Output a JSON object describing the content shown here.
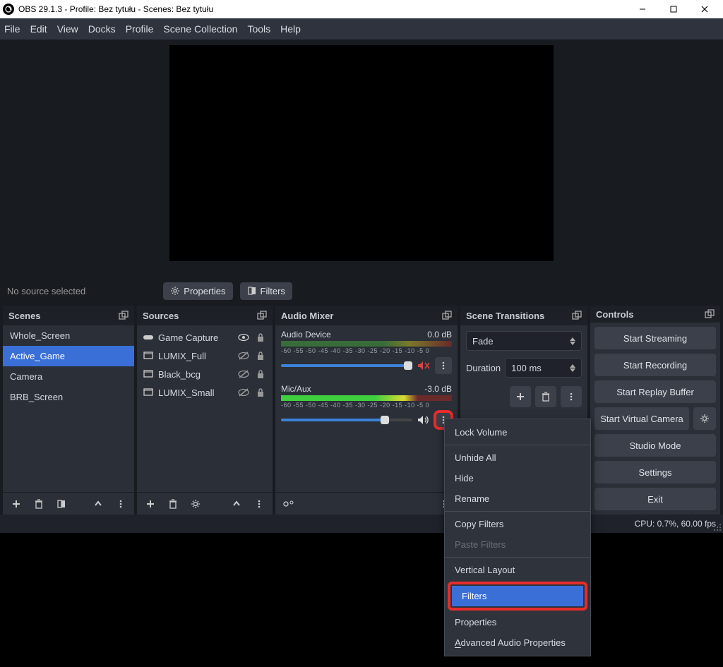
{
  "window": {
    "title": "OBS 29.1.3 - Profile: Bez tytułu - Scenes: Bez tytułu"
  },
  "menubar": [
    "File",
    "Edit",
    "View",
    "Docks",
    "Profile",
    "Scene Collection",
    "Tools",
    "Help"
  ],
  "toolbar": {
    "no_source": "No source selected",
    "properties": "Properties",
    "filters": "Filters"
  },
  "scenes": {
    "title": "Scenes",
    "items": [
      "Whole_Screen",
      "Active_Game",
      "Camera",
      "BRB_Screen"
    ],
    "active_index": 1
  },
  "sources": {
    "title": "Sources",
    "items": [
      {
        "name": "Game Capture",
        "icon": "gamepad",
        "visible": true,
        "locked": true
      },
      {
        "name": "LUMIX_Full",
        "icon": "monitor",
        "visible": false,
        "locked": true
      },
      {
        "name": "Black_bcg",
        "icon": "monitor",
        "visible": false,
        "locked": true
      },
      {
        "name": "LUMIX_Small",
        "icon": "monitor",
        "visible": false,
        "locked": true
      }
    ]
  },
  "audio": {
    "title": "Audio Mixer",
    "ticks": "-60 -55 -50 -45 -40 -35 -30 -25 -20 -15 -10 -5 0",
    "tracks": [
      {
        "name": "Audio Device",
        "db": "0.0 dB",
        "muted": true
      },
      {
        "name": "Mic/Aux",
        "db": "-3.0 dB",
        "muted": false
      }
    ]
  },
  "transitions": {
    "title": "Scene Transitions",
    "selected": "Fade",
    "duration_label": "Duration",
    "duration_value": "100 ms"
  },
  "controls": {
    "title": "Controls",
    "buttons": [
      "Start Streaming",
      "Start Recording",
      "Start Replay Buffer",
      "Start Virtual Camera",
      "Studio Mode",
      "Settings",
      "Exit"
    ]
  },
  "status": {
    "cpu": "CPU: 0.7%, 60.00 fps"
  },
  "context_menu": {
    "items": [
      {
        "label": "Lock Volume",
        "type": "normal"
      },
      {
        "sep": true
      },
      {
        "label": "Unhide All",
        "type": "normal"
      },
      {
        "label": "Hide",
        "type": "normal"
      },
      {
        "label": "Rename",
        "type": "normal"
      },
      {
        "sep": true
      },
      {
        "label": "Copy Filters",
        "type": "normal"
      },
      {
        "label": "Paste Filters",
        "type": "disabled"
      },
      {
        "sep": true
      },
      {
        "label": "Vertical Layout",
        "type": "normal"
      },
      {
        "label": "Filters",
        "type": "highlighted"
      },
      {
        "label": "Properties",
        "type": "normal"
      },
      {
        "label": "Advanced Audio Properties",
        "type": "normal",
        "underline": true
      }
    ]
  }
}
